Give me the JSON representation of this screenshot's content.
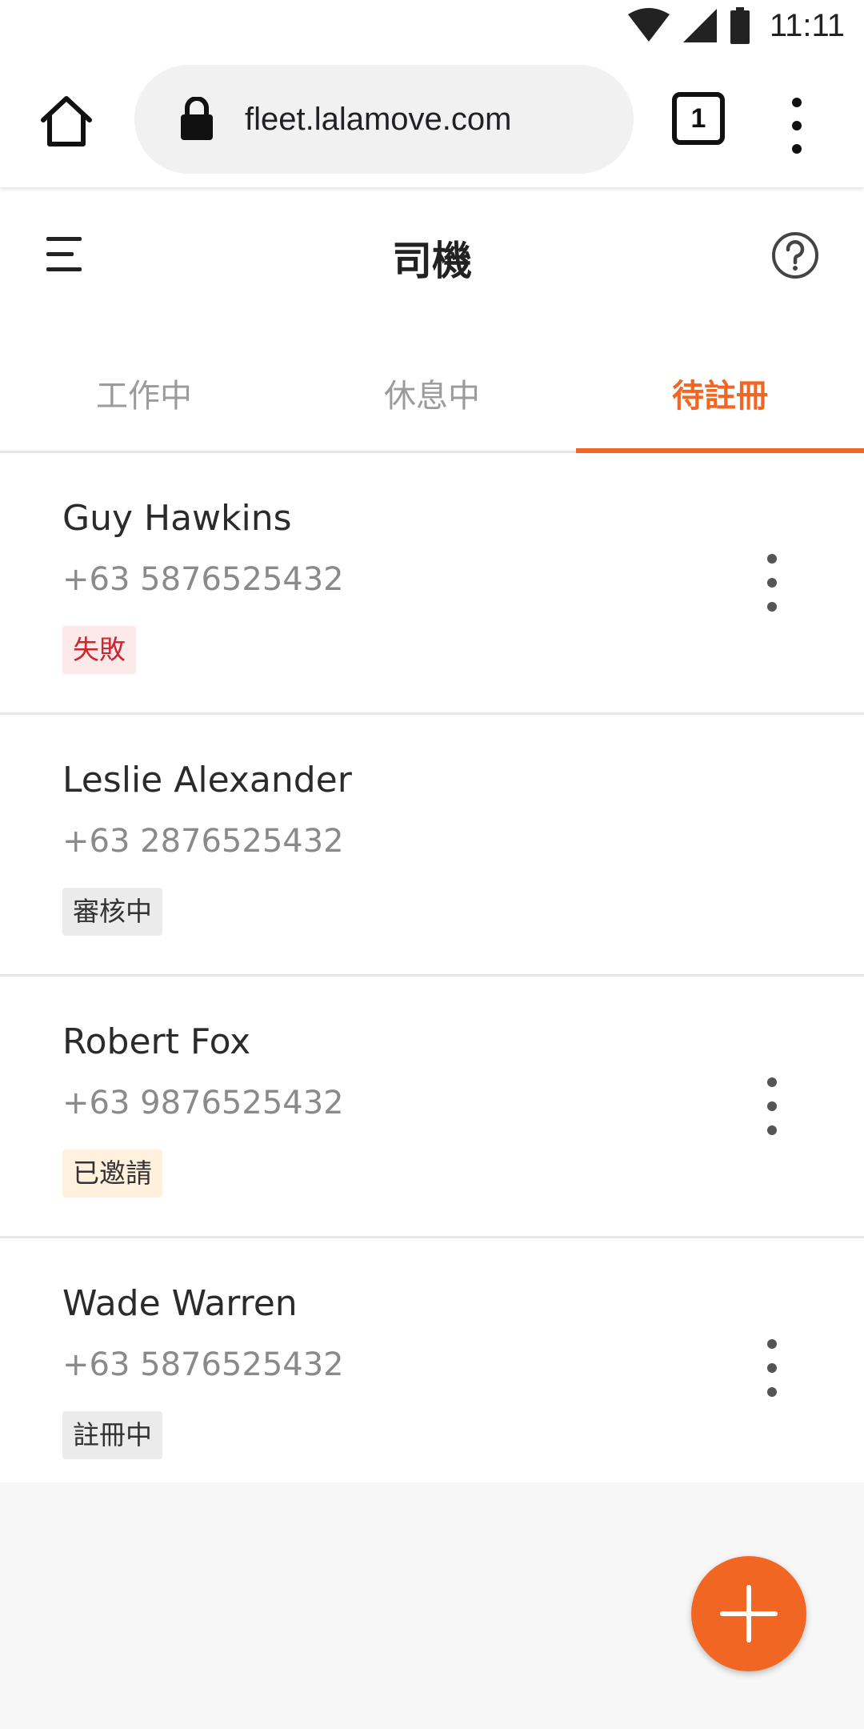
{
  "status_bar": {
    "time": "11:11",
    "icons": [
      "wifi-icon",
      "signal-icon",
      "battery-icon"
    ]
  },
  "browser": {
    "url": "fleet.lalamove.com",
    "tab_count": "1",
    "icons": [
      "home-icon",
      "lock-icon",
      "more-vert-icon"
    ]
  },
  "header": {
    "title": "司機",
    "icons": [
      "menu-icon",
      "help-icon"
    ]
  },
  "tabs": [
    {
      "label": "工作中",
      "active": false
    },
    {
      "label": "休息中",
      "active": false
    },
    {
      "label": "待註冊",
      "active": true
    }
  ],
  "drivers": [
    {
      "name": "Guy Hawkins",
      "phone": "+63 5876525432",
      "status": "失敗",
      "status_bg": "#fde8ea",
      "status_fg": "#c8282e",
      "has_menu": true
    },
    {
      "name": "Leslie Alexander",
      "phone": "+63 2876525432",
      "status": "審核中",
      "status_bg": "#ebebeb",
      "status_fg": "#333333",
      "has_menu": false
    },
    {
      "name": "Robert Fox",
      "phone": "+63 9876525432",
      "status": "已邀請",
      "status_bg": "#fff1dd",
      "status_fg": "#333333",
      "has_menu": true
    },
    {
      "name": "Wade Warren",
      "phone": "+63 5876525432",
      "status": "註冊中",
      "status_bg": "#ebebeb",
      "status_fg": "#333333",
      "has_menu": true
    }
  ],
  "colors": {
    "accent": "#f16622",
    "background": "#f7f7f7"
  },
  "fab": {
    "icon": "plus-icon"
  }
}
